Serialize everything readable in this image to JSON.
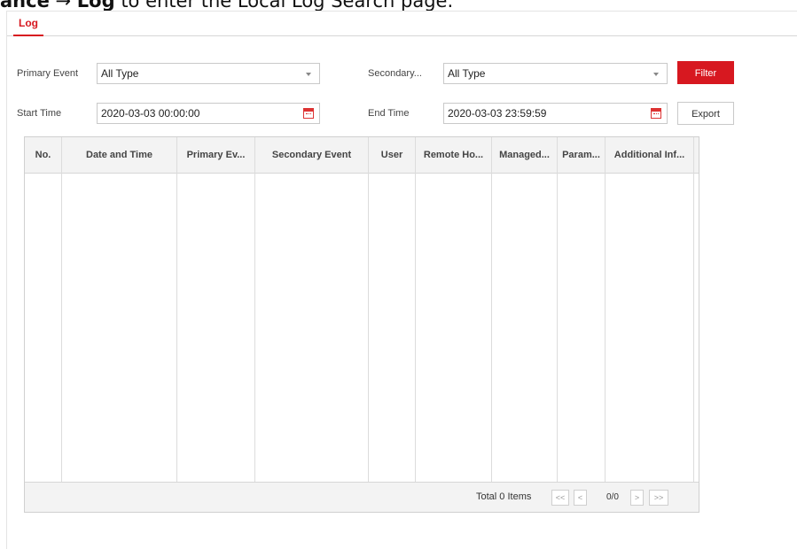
{
  "caption": {
    "path_bold_a": "ance",
    "arrow": "→",
    "path_bold_b": "Log",
    "rest": " to enter the Local Log Search page."
  },
  "tabs": [
    {
      "label": "Log"
    }
  ],
  "filters": {
    "primary_event_label": "Primary Event",
    "primary_event_value": "All Type",
    "secondary_event_label": "Secondary...",
    "secondary_event_value": "All Type",
    "start_time_label": "Start Time",
    "start_time_value": "2020-03-03 00:00:00",
    "end_time_label": "End Time",
    "end_time_value": "2020-03-03 23:59:59",
    "filter_button": "Filter",
    "export_button": "Export"
  },
  "table": {
    "columns": [
      "No.",
      "Date and Time",
      "Primary Ev...",
      "Secondary Event",
      "User",
      "Remote Ho...",
      "Managed...",
      "Param...",
      "Additional Inf..."
    ],
    "rows": []
  },
  "pagination": {
    "total_text": "Total 0 Items",
    "first": "<<",
    "prev": "<",
    "page_info": "0/0",
    "next": ">",
    "last": ">>"
  },
  "colors": {
    "accent": "#d71820",
    "header_bg": "#f3f3f3",
    "border": "#d0d0d0"
  },
  "icons": {
    "calendar": "calendar-icon",
    "dropdown": "chevron-down-icon"
  }
}
